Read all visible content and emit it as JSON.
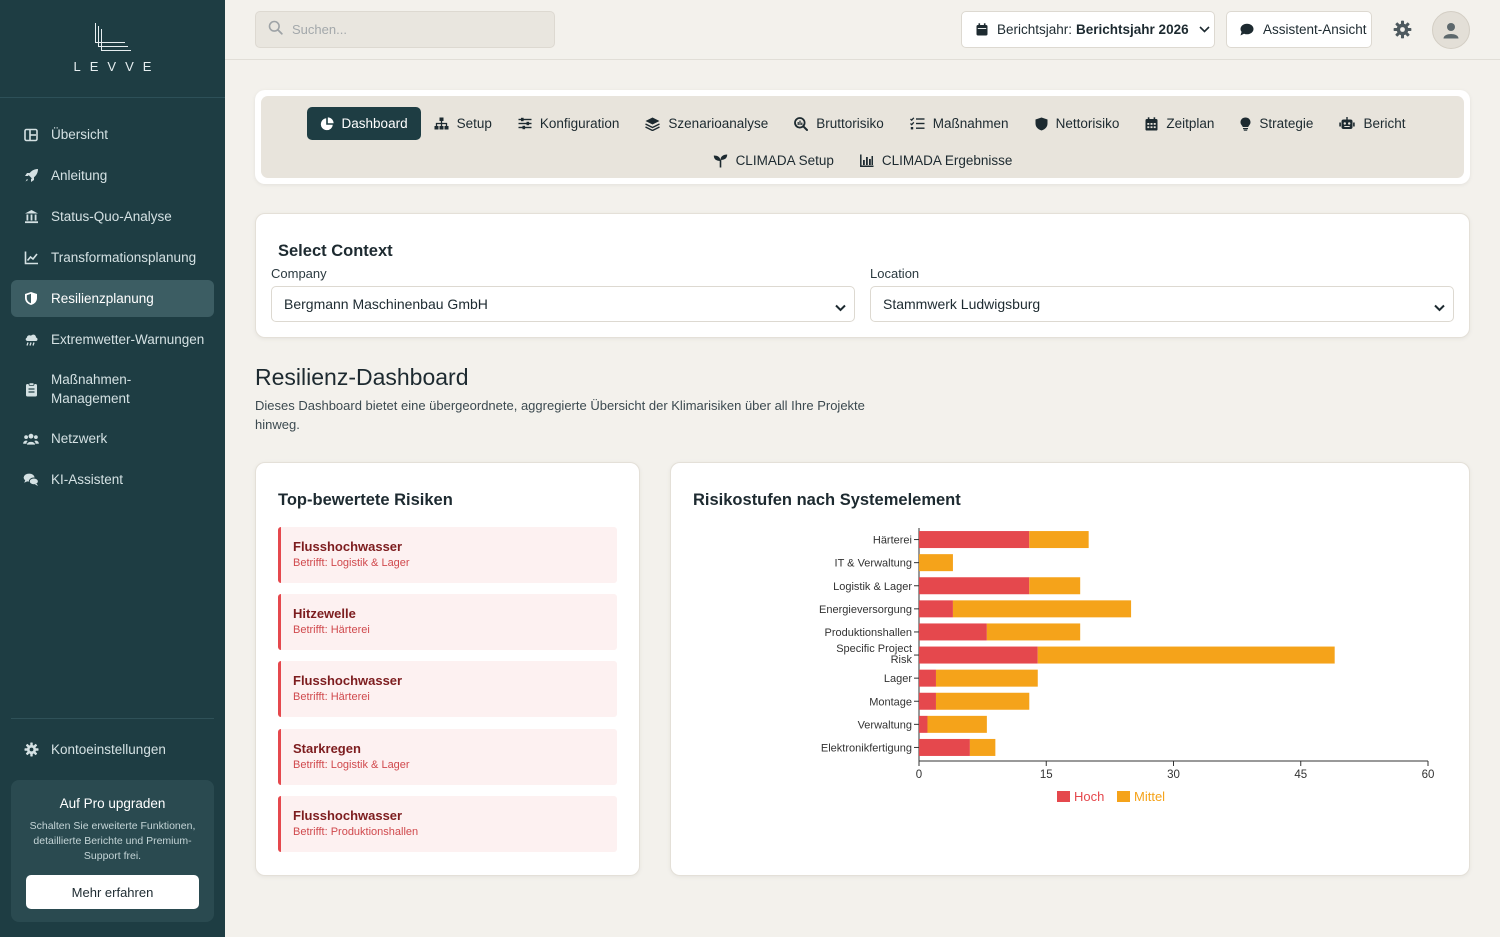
{
  "brand": {
    "logo_text": "LEVVE"
  },
  "sidebar": {
    "items": [
      {
        "label": "Übersicht",
        "icon": "overview-icon"
      },
      {
        "label": "Anleitung",
        "icon": "rocket-icon"
      },
      {
        "label": "Status-Quo-Analyse",
        "icon": "bank-icon"
      },
      {
        "label": "Transformationsplanung",
        "icon": "line-chart-icon"
      },
      {
        "label": "Resilienzplanung",
        "icon": "shield-icon",
        "active": true
      },
      {
        "label": "Extremwetter-Warnungen",
        "icon": "cloud-rain-icon"
      },
      {
        "label": "Maßnahmen-\nManagement",
        "icon": "clipboard-icon"
      },
      {
        "label": "Netzwerk",
        "icon": "users-icon"
      },
      {
        "label": "KI-Assistent",
        "icon": "chat-bubbles-icon"
      }
    ],
    "settings_label": "Kontoeinstellungen",
    "upgrade": {
      "title": "Auf Pro upgraden",
      "text": "Schalten Sie erweiterte Funktionen, detaillierte Berichte und Premium-Support frei.",
      "button": "Mehr erfahren"
    }
  },
  "topbar": {
    "search_placeholder": "Suchen...",
    "year_prefix": "Berichtsjahr:",
    "year_value": "Berichtsjahr 2026",
    "assistant_label": "Assistent-Ansicht"
  },
  "tabs": {
    "row1": [
      "Dashboard",
      "Setup",
      "Konfiguration",
      "Szenarioanalyse",
      "Bruttorisiko",
      "Maßnahmen",
      "Nettorisiko",
      "Zeitplan",
      "Strategie",
      "Bericht"
    ],
    "row2": [
      "CLIMADA Setup",
      "CLIMADA Ergebnisse"
    ],
    "active": "Dashboard"
  },
  "context": {
    "title": "Select Context",
    "company_label": "Company",
    "company_value": "Bergmann Maschinenbau GmbH",
    "location_label": "Location",
    "location_value": "Stammwerk Ludwigsburg"
  },
  "dashboard": {
    "title": "Resilienz-Dashboard",
    "description": "Dieses Dashboard bietet eine übergeordnete, aggregierte Übersicht der Klimarisiken über all Ihre Projekte hinweg."
  },
  "top_risks": {
    "title": "Top-bewertete Risiken",
    "items": [
      {
        "name": "Flusshochwasser",
        "affected": "Betrifft: Logistik & Lager"
      },
      {
        "name": "Hitzewelle",
        "affected": "Betrifft: Härterei"
      },
      {
        "name": "Flusshochwasser",
        "affected": "Betrifft: Härterei"
      },
      {
        "name": "Starkregen",
        "affected": "Betrifft: Logistik & Lager"
      },
      {
        "name": "Flusshochwasser",
        "affected": "Betrifft: Produktionshallen"
      }
    ]
  },
  "chart_panel": {
    "title": "Risikostufen nach Systemelement"
  },
  "chart_data": {
    "type": "bar",
    "orientation": "horizontal",
    "stacked": true,
    "title": "Risikostufen nach Systemelement",
    "categories": [
      "Härterei",
      "IT & Verwaltung",
      "Logistik & Lager",
      "Energieversorgung",
      "Produktionshallen",
      "Specific Project Risk",
      "Lager",
      "Montage",
      "Verwaltung",
      "Elektronikfertigung"
    ],
    "series": [
      {
        "name": "Hoch",
        "color": "#e5484d",
        "values": [
          13,
          0,
          13,
          4,
          8,
          14,
          2,
          2,
          1,
          6
        ]
      },
      {
        "name": "Mittel",
        "color": "#f5a31a",
        "values": [
          7,
          4,
          6,
          21,
          11,
          35,
          12,
          11,
          7,
          3
        ]
      }
    ],
    "xlim": [
      0,
      60
    ],
    "xticks": [
      0,
      15,
      30,
      45,
      60
    ],
    "legend_position": "bottom",
    "grid": false
  }
}
